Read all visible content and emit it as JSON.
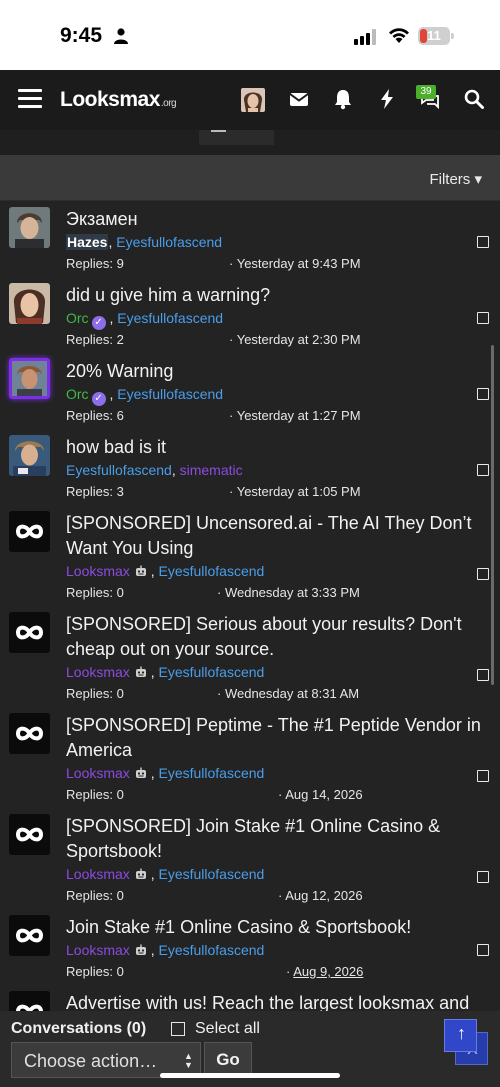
{
  "status": {
    "time": "9:45",
    "battery": "11"
  },
  "nav": {
    "logo_main": "Looksmax",
    "logo_suffix": ".org",
    "messages_badge": "39",
    "filters_label": "Filters ▾"
  },
  "colors": {
    "background": "#232323",
    "navbar": "#1b1b1b",
    "link_blue": "#4a9eea",
    "staff_green": "#3fb84a",
    "brand_purple": "#8b4be0",
    "badge_green": "#4caf2c"
  },
  "conversations": [
    {
      "title": "Экзамен",
      "participants": [
        {
          "name": "Hazes",
          "style": "bold"
        },
        {
          "name": ", ",
          "style": "plain"
        },
        {
          "name": "Eyesfullofascend",
          "style": "blue"
        }
      ],
      "replies": "Replies: 9",
      "date": "Yesterday at 9:43 PM",
      "avatar": "photo-1"
    },
    {
      "title": "did u give him a warning?",
      "participants": [
        {
          "name": "Orc",
          "style": "green",
          "verified": true
        },
        {
          "name": " , ",
          "style": "plain"
        },
        {
          "name": "Eyesfullofascend",
          "style": "blue"
        }
      ],
      "replies": "Replies: 2",
      "date": "Yesterday at 2:30 PM",
      "avatar": "photo-2"
    },
    {
      "title": "20% Warning",
      "participants": [
        {
          "name": "Orc",
          "style": "green",
          "verified": true
        },
        {
          "name": " , ",
          "style": "plain"
        },
        {
          "name": "Eyesfullofascend",
          "style": "blue"
        }
      ],
      "replies": "Replies: 6",
      "date": "Yesterday at 1:27 PM",
      "avatar": "photo-3"
    },
    {
      "title": "how bad is it",
      "participants": [
        {
          "name": "Eyesfullofascend",
          "style": "blue"
        },
        {
          "name": ", ",
          "style": "plain"
        },
        {
          "name": "simematic",
          "style": "purple"
        }
      ],
      "replies": "Replies: 3",
      "date": "Yesterday at 1:05 PM",
      "avatar": "photo-4"
    },
    {
      "title": "[SPONSORED] Uncensored.ai - The AI They Don’t Want You Using",
      "participants": [
        {
          "name": "Looksmax",
          "style": "purple",
          "bot": true
        },
        {
          "name": " , ",
          "style": "plain"
        },
        {
          "name": "Eyesfullofascend",
          "style": "blue"
        }
      ],
      "replies": "Replies: 0",
      "date": "Wednesday at 3:33 PM",
      "avatar": "logo"
    },
    {
      "title": "[SPONSORED] Serious about your results? Don't cheap out on your source.",
      "participants": [
        {
          "name": "Looksmax",
          "style": "purple",
          "bot": true
        },
        {
          "name": " , ",
          "style": "plain"
        },
        {
          "name": "Eyesfullofascend",
          "style": "blue"
        }
      ],
      "replies": "Replies: 0",
      "date": "Wednesday at 8:31 AM",
      "avatar": "logo"
    },
    {
      "title": "[SPONSORED] Peptime - The #1 Peptide Vendor in America",
      "participants": [
        {
          "name": "Looksmax",
          "style": "purple",
          "bot": true
        },
        {
          "name": " , ",
          "style": "plain"
        },
        {
          "name": "Eyesfullofascend",
          "style": "blue"
        }
      ],
      "replies": "Replies: 0",
      "date": "Aug 14, 2026",
      "avatar": "logo"
    },
    {
      "title": "[SPONSORED] Join Stake #1 Online Casino & Sportsbook!",
      "participants": [
        {
          "name": "Looksmax",
          "style": "purple",
          "bot": true
        },
        {
          "name": " , ",
          "style": "plain"
        },
        {
          "name": "Eyesfullofascend",
          "style": "blue"
        }
      ],
      "replies": "Replies: 0",
      "date": "Aug 12, 2026",
      "avatar": "logo"
    },
    {
      "title": "Join Stake #1 Online Casino & Sportsbook!",
      "participants": [
        {
          "name": "Looksmax",
          "style": "purple",
          "bot": true
        },
        {
          "name": " , ",
          "style": "plain"
        },
        {
          "name": "Eyesfullofascend",
          "style": "blue"
        }
      ],
      "replies": "Replies: 0",
      "date": "Aug 9, 2026",
      "avatar": "logo"
    },
    {
      "title": "Advertise with us! Reach the largest looksmax and",
      "participants": [],
      "replies": "",
      "date": "",
      "avatar": "logo"
    }
  ],
  "bottom": {
    "conversations_label": "Conversations (0)",
    "select_all": "Select all",
    "action_placeholder": "Choose action…",
    "go": "Go",
    "scroll_top": "↑",
    "close": "X"
  }
}
